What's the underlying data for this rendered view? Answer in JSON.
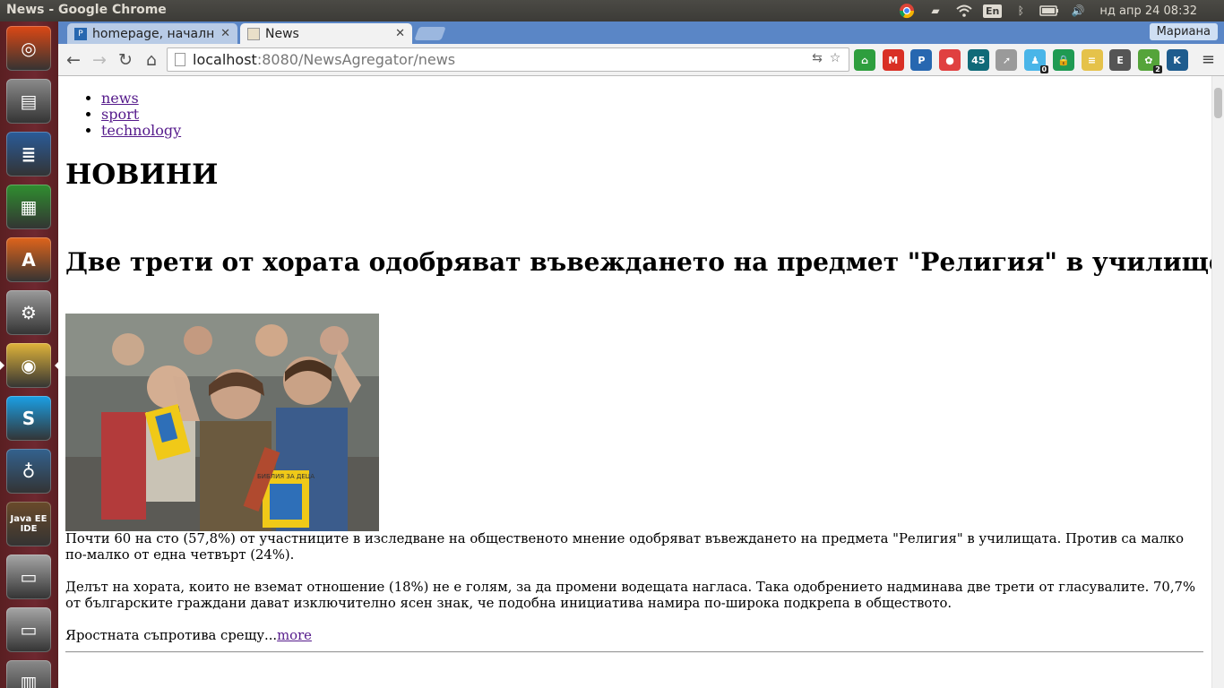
{
  "window": {
    "title": "News - Google Chrome"
  },
  "tray": {
    "keyboard_layout": "En",
    "clock": "нд апр 24 08:32"
  },
  "launcher": {
    "items": [
      {
        "name": "ubuntu-dash-icon",
        "color": "#dd4814"
      },
      {
        "name": "files-icon",
        "color": "#8b8b8b"
      },
      {
        "name": "writer-icon",
        "color": "#2a5c9a"
      },
      {
        "name": "calc-icon",
        "color": "#2f8f2f"
      },
      {
        "name": "software-center-icon",
        "color": "#e0641b"
      },
      {
        "name": "system-settings-icon",
        "color": "#9a9a9a"
      },
      {
        "name": "chrome-icon",
        "color": "#e0b43a"
      },
      {
        "name": "skype-icon",
        "color": "#1aa0e6"
      },
      {
        "name": "pgadmin-icon",
        "color": "#33628f"
      },
      {
        "name": "java-ee-ide-icon",
        "color": "#6a4a2a",
        "label": "Java EE IDE"
      },
      {
        "name": "drive-icon",
        "color": "#a6a6a6"
      },
      {
        "name": "drive-icon",
        "color": "#a6a6a6"
      },
      {
        "name": "trash-icon",
        "color": "#8a8a8a"
      }
    ]
  },
  "tabs": [
    {
      "title": "homepage, начална",
      "active": false
    },
    {
      "title": "News",
      "active": true
    }
  ],
  "profile": {
    "name": "Мариана"
  },
  "omnibox": {
    "host": "localhost",
    "rest": ":8080/NewsAgregator/news"
  },
  "extensions": [
    {
      "name": "home-ext-icon",
      "color": "#2e9e3e",
      "glyph": "⌂"
    },
    {
      "name": "gmail-ext-icon",
      "color": "#d93025",
      "glyph": "M"
    },
    {
      "name": "pb-ext-icon",
      "color": "#2767b0",
      "glyph": "P"
    },
    {
      "name": "tomato-ext-icon",
      "color": "#e04040",
      "glyph": "●"
    },
    {
      "name": "45-ext-icon",
      "color": "#0f6a78",
      "glyph": "45"
    },
    {
      "name": "pin-ext-icon",
      "color": "#9a9a9a",
      "glyph": "➚"
    },
    {
      "name": "ghost-ext-icon",
      "color": "#49b5e8",
      "glyph": "♟",
      "badge": "0"
    },
    {
      "name": "lock-ext-icon",
      "color": "#1f9a52",
      "glyph": "🔒"
    },
    {
      "name": "note-ext-icon",
      "color": "#e5c24a",
      "glyph": "≡"
    },
    {
      "name": "evernote-ext-icon",
      "color": "#555555",
      "glyph": "E"
    },
    {
      "name": "leaf-ext-icon",
      "color": "#55a43a",
      "glyph": "✿",
      "badge": "2"
    },
    {
      "name": "k-ext-icon",
      "color": "#1e5c8e",
      "glyph": "K"
    }
  ],
  "page": {
    "nav_links": [
      "news",
      "sport",
      "technology"
    ],
    "heading": "НОВИНИ",
    "article_title": "Две трети от хората одобряват въвеждането на предмет \"Религия\" в училище",
    "paragraphs": [
      "Почти 60 на сто (57,8%) от участниците в изследване на общественото мнение одобряват въвеждането на предмета \"Религия\" в училищата. Против са малко по-малко от една четвърт (24%).",
      "Делът на хората, които не вземат отношение (18%) не е голям, за да промени водещата нагласа. Така одобрението надминава две трети от гласувалите. 70,7% от българските граждани дават изключително ясен знак, че подобна инициатива намира по-широка подкрепа в обществото."
    ],
    "teaser": "Яростната съпротива срещу...",
    "more_link": "more",
    "book_title": "БИБЛИЯ ЗА ДЕЦА"
  }
}
